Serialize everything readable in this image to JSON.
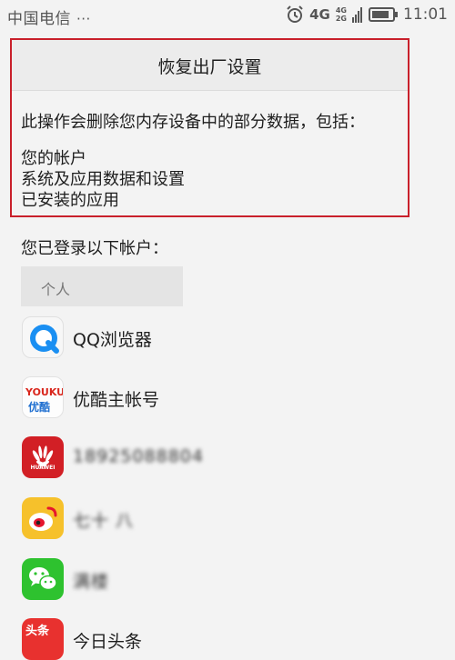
{
  "status_bar": {
    "carrier": "中国电信",
    "carrier_more": "···",
    "network": "4G",
    "network_small_top": "4G",
    "network_small_bottom": "2G",
    "time": "11:01"
  },
  "dialog": {
    "title": "恢复出厂设置",
    "description": "此操作会删除您内存设备中的部分数据，包括：",
    "items": [
      "您的帐户",
      "系统及应用数据和设置",
      "已安装的应用"
    ]
  },
  "accounts": {
    "label": "您已登录以下帐户：",
    "section": "个人",
    "list": [
      {
        "name": "QQ浏览器",
        "icon": "qq-browser-icon"
      },
      {
        "name": "优酷主帐号",
        "icon": "youku-icon",
        "icon_text_en": "YOUKU",
        "icon_text_cn": "优酷"
      },
      {
        "name": "18925088804",
        "icon": "huawei-icon",
        "icon_text": "HUAWEI"
      },
      {
        "name": "七十 八",
        "icon": "weibo-icon"
      },
      {
        "name": "满楼",
        "icon": "wechat-icon"
      },
      {
        "name": "今日头条",
        "icon": "toutiao-icon",
        "icon_text": "头条"
      }
    ]
  },
  "colors": {
    "highlight_border": "#c9202b",
    "background": "#f3f3f3"
  }
}
